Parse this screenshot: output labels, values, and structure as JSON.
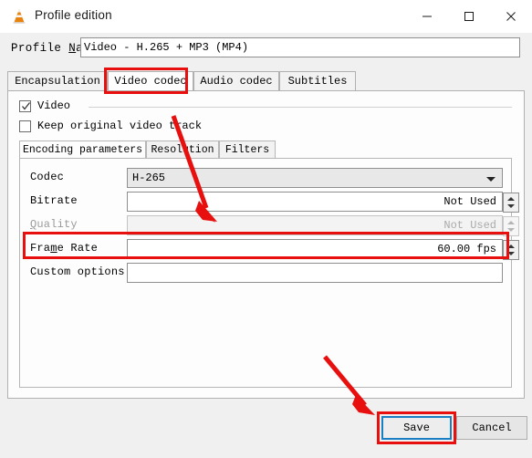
{
  "window": {
    "title": "Profile edition",
    "icon": "vlc-cone-icon",
    "controls": {
      "minimize": "minimize-icon",
      "maximize": "maximize-icon",
      "close": "close-icon"
    }
  },
  "profile": {
    "label_prefix": "Profile ",
    "label_mnemonic": "N",
    "label_suffix": "ame",
    "value": "Video - H.265 + MP3 (MP4)",
    "placeholder": ""
  },
  "tabs": [
    {
      "label": "Encapsulation",
      "selected": false
    },
    {
      "label": "Video codec",
      "selected": true
    },
    {
      "label": "Audio codec",
      "selected": false
    },
    {
      "label": "Subtitles",
      "selected": false
    }
  ],
  "video_group": {
    "video_checkbox": {
      "label": "Video",
      "checked": true
    },
    "keep_original_checkbox": {
      "label": "Keep original video track",
      "checked": false
    }
  },
  "subtabs": [
    {
      "label": "Encoding parameters",
      "selected": true
    },
    {
      "label": "Resolution",
      "selected": false
    },
    {
      "label": "Filters",
      "selected": false
    }
  ],
  "form": {
    "codec": {
      "label": "Codec",
      "value": "H-265",
      "type": "combobox",
      "enabled": true
    },
    "bitrate": {
      "label_prefix": "",
      "label": "Bitrate",
      "value": "Not Used",
      "type": "spinbox",
      "enabled": true
    },
    "quality": {
      "label_prefix": "",
      "label_mnemonic": "Q",
      "label_suffix": "uality",
      "value": "Not Used",
      "type": "spinbox",
      "enabled": false
    },
    "frame_rate": {
      "label_part1": "Fra",
      "label_mnemonic": "m",
      "label_part2": "e Rate",
      "value": "60.00 fps",
      "type": "spinbox",
      "enabled": true
    },
    "custom_options": {
      "label": "Custom options",
      "value": "",
      "type": "text",
      "enabled": true
    }
  },
  "footer": {
    "save_label": "Save",
    "cancel_label": "Cancel"
  },
  "annotations": {
    "highlight_color": "#e8100f",
    "boxes": [
      "Video codec tab",
      "Frame Rate row",
      "Save button"
    ],
    "arrows": 2
  }
}
